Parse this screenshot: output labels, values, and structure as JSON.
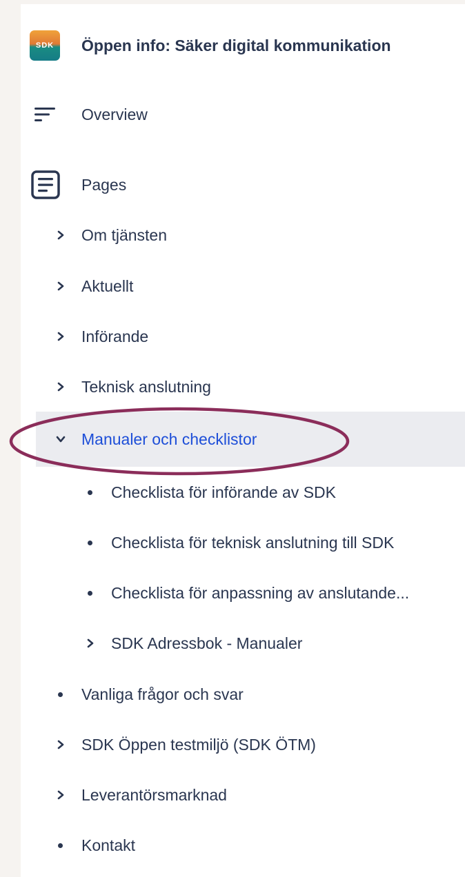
{
  "space": {
    "logo_text": "SDK",
    "title": "Öppen info: Säker digital kommunikation"
  },
  "nav": {
    "overview_label": "Overview",
    "pages_label": "Pages"
  },
  "tree": {
    "om_tjansten": "Om tjänsten",
    "aktuellt": "Aktuellt",
    "inforande": "Införande",
    "teknisk_anslutning": "Teknisk anslutning",
    "manualer": "Manualer och checklistor",
    "manualer_children": {
      "checklista_inforande": "Checklista för införande av SDK",
      "checklista_teknisk": "Checklista för teknisk anslutning till SDK",
      "checklista_anpassning": "Checklista för anpassning av anslutande...",
      "adressbok": "SDK Adressbok - Manualer"
    },
    "vanliga_fragor": "Vanliga frågor och svar",
    "oppen_testmiljo": "SDK Öppen testmiljö (SDK ÖTM)",
    "leverantorsmarknad": "Leverantörsmarknad",
    "kontakt": "Kontakt"
  },
  "colors": {
    "active_text": "#1d4ed8",
    "active_bg": "#ebecf0",
    "annotation_ellipse": "#8b2d5a"
  },
  "annotation": {
    "ellipse_target": "Manualer och checklistor"
  }
}
